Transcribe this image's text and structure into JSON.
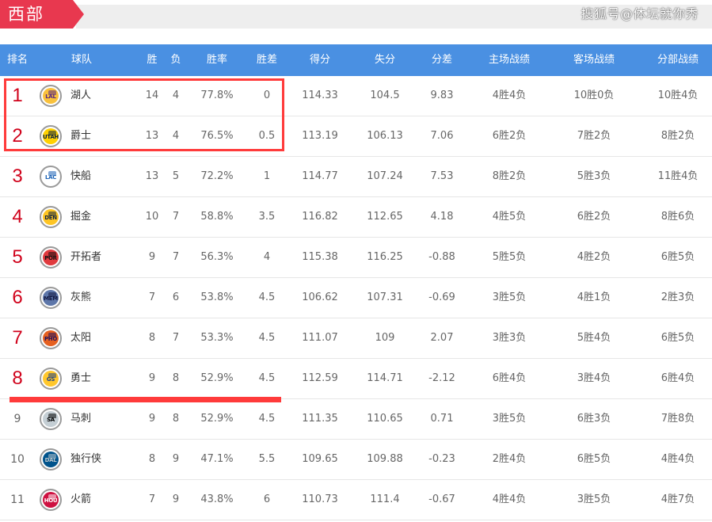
{
  "section": {
    "title": "西部"
  },
  "watermark": "搜狐号@体坛就你秀",
  "columns": {
    "rank": "排名",
    "team": "球队",
    "wins": "胜",
    "losses": "负",
    "pct": "胜率",
    "gb": "胜差",
    "ppg": "得分",
    "oppg": "失分",
    "diff": "分差",
    "home": "主场战绩",
    "away": "客场战绩",
    "div": "分部战绩"
  },
  "colors": {
    "header_bg": "#4a90e2",
    "tab_bg": "#e8384f",
    "highlight": "#ff3b3b",
    "rank_highlight": "#d0021b"
  },
  "rows": [
    {
      "rank": "1",
      "team": "湖人",
      "logo": "LAL",
      "logo_colors": [
        "#f9c13b",
        "#552583"
      ],
      "w": "14",
      "l": "4",
      "pct": "77.8%",
      "gb": "0",
      "ppg": "114.33",
      "oppg": "104.5",
      "diff": "9.83",
      "home": "4胜4负",
      "away": "10胜0负",
      "div": "10胜4负",
      "highlight": true
    },
    {
      "rank": "2",
      "team": "爵士",
      "logo": "UTAH",
      "logo_colors": [
        "#ffd100",
        "#0b2240"
      ],
      "w": "13",
      "l": "4",
      "pct": "76.5%",
      "gb": "0.5",
      "ppg": "113.19",
      "oppg": "106.13",
      "diff": "7.06",
      "home": "6胜2负",
      "away": "7胜2负",
      "div": "8胜2负",
      "highlight": true
    },
    {
      "rank": "3",
      "team": "快船",
      "logo": "LAC",
      "logo_colors": [
        "#ffffff",
        "#1d63b6"
      ],
      "w": "13",
      "l": "5",
      "pct": "72.2%",
      "gb": "1",
      "ppg": "114.77",
      "oppg": "107.24",
      "diff": "7.53",
      "home": "8胜2负",
      "away": "5胜3负",
      "div": "11胜4负",
      "highlight": true
    },
    {
      "rank": "4",
      "team": "掘金",
      "logo": "DEN",
      "logo_colors": [
        "#fec524",
        "#0e2240"
      ],
      "w": "10",
      "l": "7",
      "pct": "58.8%",
      "gb": "3.5",
      "ppg": "116.82",
      "oppg": "112.65",
      "diff": "4.18",
      "home": "4胜5负",
      "away": "6胜2负",
      "div": "8胜6负",
      "highlight": true
    },
    {
      "rank": "5",
      "team": "开拓者",
      "logo": "POR",
      "logo_colors": [
        "#e03a3e",
        "#111111"
      ],
      "w": "9",
      "l": "7",
      "pct": "56.3%",
      "gb": "4",
      "ppg": "115.38",
      "oppg": "116.25",
      "diff": "-0.88",
      "home": "5胜5负",
      "away": "4胜2负",
      "div": "6胜5负",
      "highlight": true
    },
    {
      "rank": "6",
      "team": "灰熊",
      "logo": "MEM",
      "logo_colors": [
        "#5d76a9",
        "#12173f"
      ],
      "w": "7",
      "l": "6",
      "pct": "53.8%",
      "gb": "4.5",
      "ppg": "106.62",
      "oppg": "107.31",
      "diff": "-0.69",
      "home": "3胜5负",
      "away": "4胜1负",
      "div": "2胜3负",
      "highlight": true
    },
    {
      "rank": "7",
      "team": "太阳",
      "logo": "PHO",
      "logo_colors": [
        "#e56020",
        "#1d1160"
      ],
      "w": "8",
      "l": "7",
      "pct": "53.3%",
      "gb": "4.5",
      "ppg": "111.07",
      "oppg": "109",
      "diff": "2.07",
      "home": "3胜3负",
      "away": "5胜4负",
      "div": "6胜5负",
      "highlight": true
    },
    {
      "rank": "8",
      "team": "勇士",
      "logo": "GS",
      "logo_colors": [
        "#ffc72c",
        "#1d428a"
      ],
      "w": "9",
      "l": "8",
      "pct": "52.9%",
      "gb": "4.5",
      "ppg": "112.59",
      "oppg": "114.71",
      "diff": "-2.12",
      "home": "6胜4负",
      "away": "3胜4负",
      "div": "6胜4负",
      "highlight": true
    },
    {
      "rank": "9",
      "team": "马刺",
      "logo": "SA",
      "logo_colors": [
        "#c4ced4",
        "#000000"
      ],
      "w": "9",
      "l": "8",
      "pct": "52.9%",
      "gb": "4.5",
      "ppg": "111.35",
      "oppg": "110.65",
      "diff": "0.71",
      "home": "3胜5负",
      "away": "6胜3负",
      "div": "7胜8负",
      "highlight": false
    },
    {
      "rank": "10",
      "team": "独行侠",
      "logo": "DAL",
      "logo_colors": [
        "#00538c",
        "#b8c4ca"
      ],
      "w": "8",
      "l": "9",
      "pct": "47.1%",
      "gb": "5.5",
      "ppg": "109.65",
      "oppg": "109.88",
      "diff": "-0.23",
      "home": "2胜4负",
      "away": "6胜5负",
      "div": "4胜4负",
      "highlight": false
    },
    {
      "rank": "11",
      "team": "火箭",
      "logo": "HOU",
      "logo_colors": [
        "#ce1141",
        "#ffffff"
      ],
      "w": "7",
      "l": "9",
      "pct": "43.8%",
      "gb": "6",
      "ppg": "110.73",
      "oppg": "111.4",
      "diff": "-0.67",
      "home": "4胜4负",
      "away": "3胜5负",
      "div": "4胜7负",
      "highlight": false
    }
  ]
}
